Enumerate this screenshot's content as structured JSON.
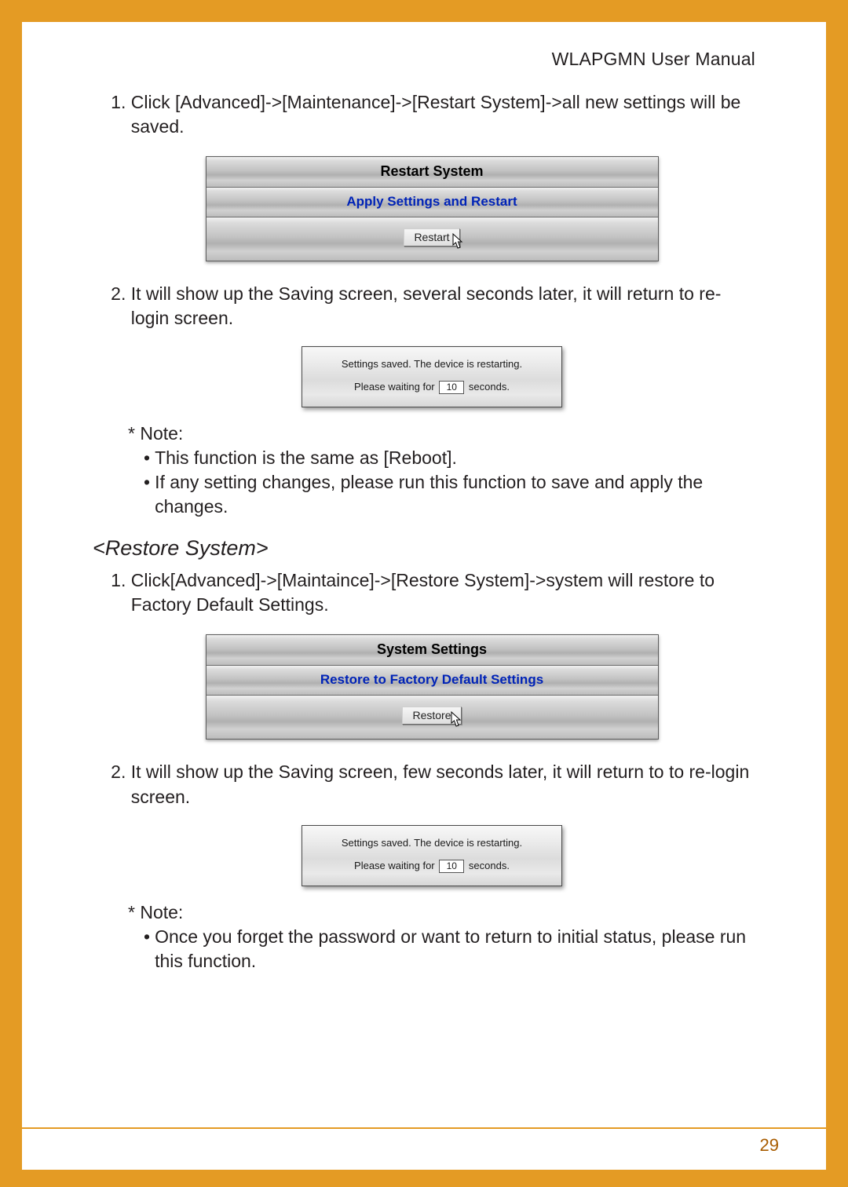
{
  "header": {
    "title": "WLAPGMN User Manual"
  },
  "page_number": "29",
  "restart": {
    "step1": "Click [Advanced]->[Maintenance]->[Restart System]->all new settings will be saved.",
    "step2": "It will show up the Saving screen, several seconds later, it will return to re-login screen.",
    "panel": {
      "title": "Restart System",
      "subtitle": "Apply Settings and Restart",
      "button_label": "Restart"
    },
    "note_label": "* Note:",
    "note1": "This function is the same as [Reboot].",
    "note2": "If any setting changes, please run this function to save and apply the changes."
  },
  "restore": {
    "section_title": "<Restore System>",
    "step1": "Click[Advanced]->[Maintaince]->[Restore System]->system will restore to Factory Default Settings.",
    "step2": "It will show up the Saving screen, few seconds later, it will return to to re-login screen.",
    "panel": {
      "title": "System Settings",
      "subtitle": "Restore to Factory Default Settings",
      "button_label": "Restore"
    },
    "note_label": "* Note:",
    "note1": "Once you forget the password or want to return to initial status, please run this function."
  },
  "dialog": {
    "line1": "Settings saved. The device is restarting.",
    "line2_pre": "Please waiting for",
    "count": "10",
    "line2_post": "seconds."
  }
}
